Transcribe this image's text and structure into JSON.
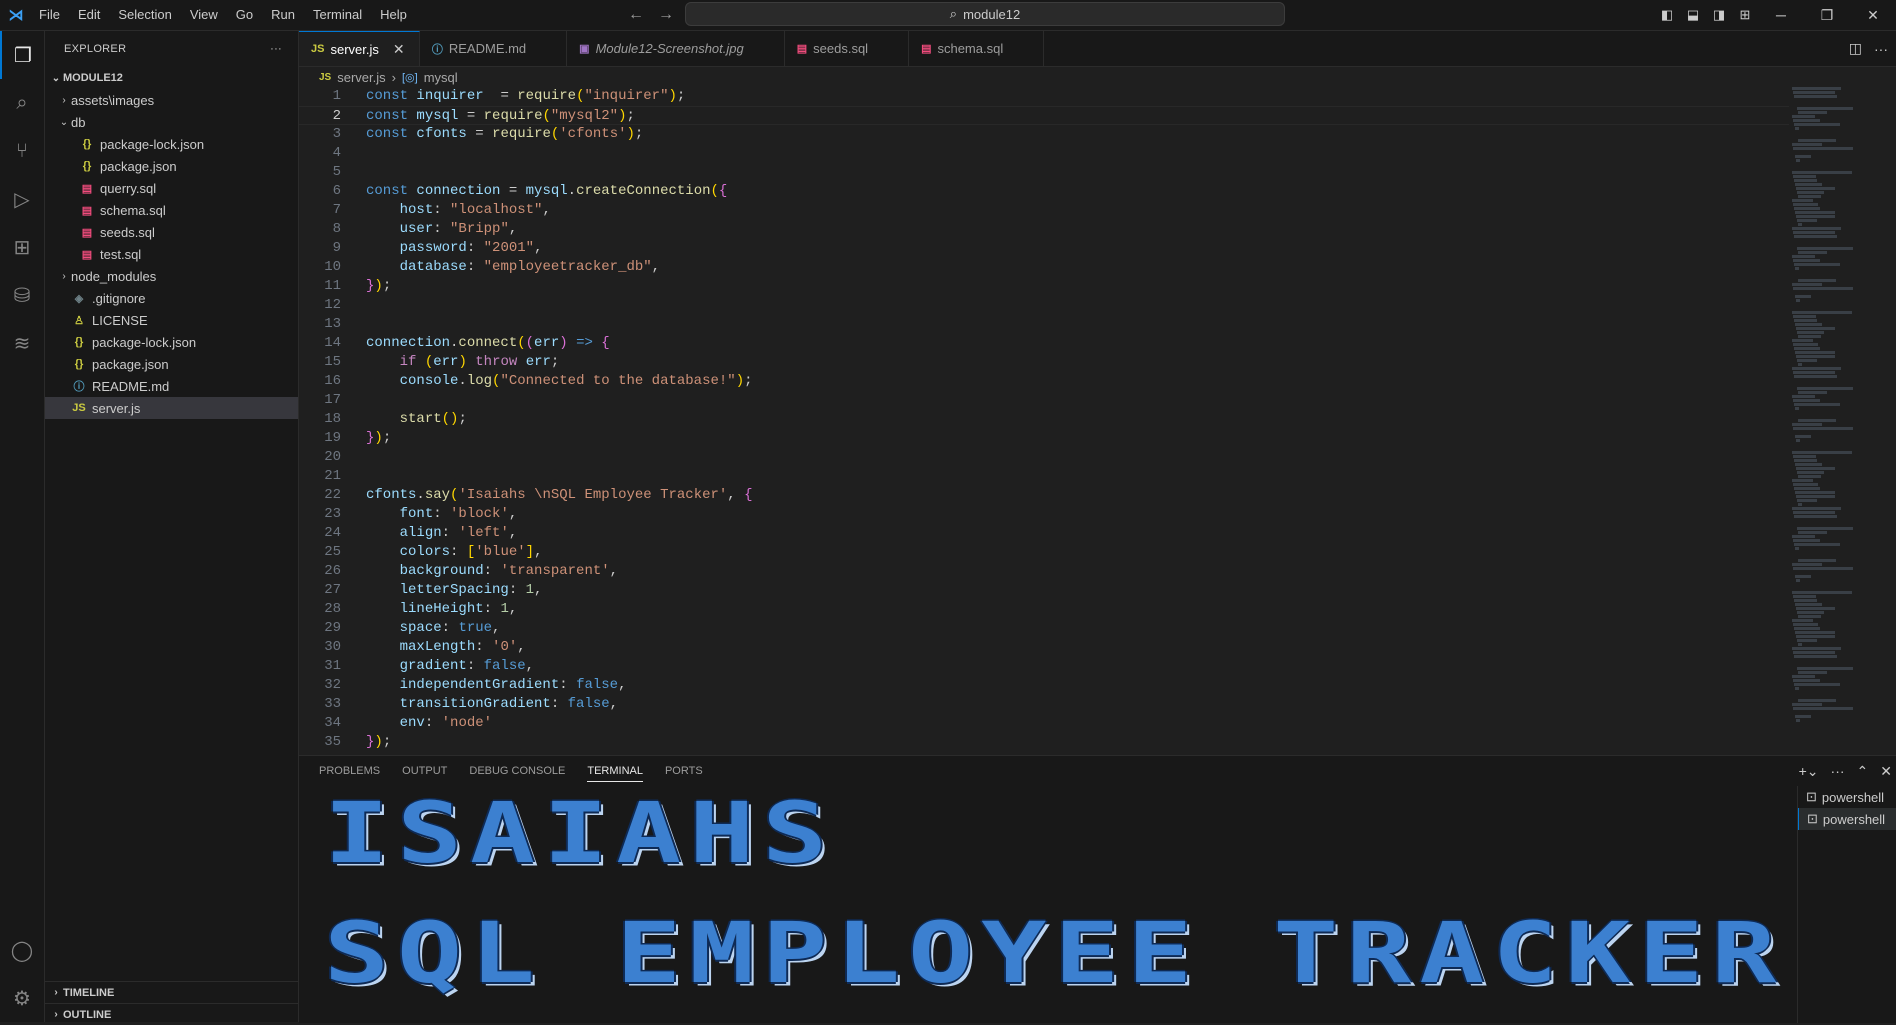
{
  "titlebar": {
    "menu": [
      "File",
      "Edit",
      "Selection",
      "View",
      "Go",
      "Run",
      "Terminal",
      "Help"
    ],
    "search_text": "module12"
  },
  "sidebar": {
    "title": "EXPLORER",
    "root": "MODULE12",
    "tree": [
      {
        "label": "assets\\images",
        "indent": 1,
        "twisty": "›",
        "icon": "",
        "icon_color": ""
      },
      {
        "label": "db",
        "indent": 1,
        "twisty": "⌄",
        "icon": "",
        "icon_color": ""
      },
      {
        "label": "package-lock.json",
        "indent": 2,
        "twisty": "",
        "icon": "{}",
        "icon_color": "#cbcb41"
      },
      {
        "label": "package.json",
        "indent": 2,
        "twisty": "",
        "icon": "{}",
        "icon_color": "#cbcb41"
      },
      {
        "label": "querry.sql",
        "indent": 2,
        "twisty": "",
        "icon": "▤",
        "icon_color": "#f14c7d"
      },
      {
        "label": "schema.sql",
        "indent": 2,
        "twisty": "",
        "icon": "▤",
        "icon_color": "#f14c7d"
      },
      {
        "label": "seeds.sql",
        "indent": 2,
        "twisty": "",
        "icon": "▤",
        "icon_color": "#f14c7d"
      },
      {
        "label": "test.sql",
        "indent": 2,
        "twisty": "",
        "icon": "▤",
        "icon_color": "#f14c7d"
      },
      {
        "label": "node_modules",
        "indent": 1,
        "twisty": "›",
        "icon": "",
        "icon_color": ""
      },
      {
        "label": ".gitignore",
        "indent": 1,
        "twisty": "",
        "icon": "◈",
        "icon_color": "#6d8086"
      },
      {
        "label": "LICENSE",
        "indent": 1,
        "twisty": "",
        "icon": "♙",
        "icon_color": "#cbcb41"
      },
      {
        "label": "package-lock.json",
        "indent": 1,
        "twisty": "",
        "icon": "{}",
        "icon_color": "#cbcb41"
      },
      {
        "label": "package.json",
        "indent": 1,
        "twisty": "",
        "icon": "{}",
        "icon_color": "#cbcb41"
      },
      {
        "label": "README.md",
        "indent": 1,
        "twisty": "",
        "icon": "ⓘ",
        "icon_color": "#519aba"
      },
      {
        "label": "server.js",
        "indent": 1,
        "twisty": "",
        "icon": "JS",
        "icon_color": "#cbcb41",
        "selected": true
      }
    ],
    "timeline": "TIMELINE",
    "outline": "OUTLINE"
  },
  "tabs": [
    {
      "label": "server.js",
      "icon": "JS",
      "icon_color": "#cbcb41",
      "active": true,
      "italic": false
    },
    {
      "label": "README.md",
      "icon": "ⓘ",
      "icon_color": "#519aba",
      "active": false,
      "italic": false
    },
    {
      "label": "Module12-Screenshot.jpg",
      "icon": "▣",
      "icon_color": "#a074c4",
      "active": false,
      "italic": true
    },
    {
      "label": "seeds.sql",
      "icon": "▤",
      "icon_color": "#f14c7d",
      "active": false,
      "italic": false
    },
    {
      "label": "schema.sql",
      "icon": "▤",
      "icon_color": "#f14c7d",
      "active": false,
      "italic": false
    }
  ],
  "breadcrumb": {
    "file": "server.js",
    "symbol": "mysql"
  },
  "editor": {
    "current_line": 2,
    "lines": [
      [
        [
          "kw",
          "const "
        ],
        [
          "var",
          "inquirer"
        ],
        [
          "",
          "  = "
        ],
        [
          "fn",
          "require"
        ],
        [
          "pun",
          "("
        ],
        [
          "str",
          "\"inquirer\""
        ],
        [
          "pun",
          ")"
        ],
        [
          "",
          ";"
        ]
      ],
      [
        [
          "kw",
          "const "
        ],
        [
          "var",
          "mysql"
        ],
        [
          "",
          " = "
        ],
        [
          "fn",
          "require"
        ],
        [
          "pun",
          "("
        ],
        [
          "str",
          "\"mysql2\""
        ],
        [
          "pun",
          ")"
        ],
        [
          "",
          ";"
        ]
      ],
      [
        [
          "kw",
          "const "
        ],
        [
          "var",
          "cfonts"
        ],
        [
          "",
          " = "
        ],
        [
          "fn",
          "require"
        ],
        [
          "pun",
          "("
        ],
        [
          "str",
          "'cfonts'"
        ],
        [
          "pun",
          ")"
        ],
        [
          "",
          ";"
        ]
      ],
      [],
      [],
      [
        [
          "kw",
          "const "
        ],
        [
          "var",
          "connection"
        ],
        [
          "",
          " = "
        ],
        [
          "var",
          "mysql"
        ],
        [
          "",
          "."
        ],
        [
          "fn",
          "createConnection"
        ],
        [
          "pun",
          "("
        ],
        [
          "pun2",
          "{"
        ]
      ],
      [
        [
          "",
          "    "
        ],
        [
          "var",
          "host"
        ],
        [
          "",
          ": "
        ],
        [
          "str",
          "\"localhost\""
        ],
        [
          "",
          ","
        ]
      ],
      [
        [
          "",
          "    "
        ],
        [
          "var",
          "user"
        ],
        [
          "",
          ": "
        ],
        [
          "str",
          "\"Bripp\""
        ],
        [
          "",
          ","
        ]
      ],
      [
        [
          "",
          "    "
        ],
        [
          "var",
          "password"
        ],
        [
          "",
          ": "
        ],
        [
          "str",
          "\"2001\""
        ],
        [
          "",
          ","
        ]
      ],
      [
        [
          "",
          "    "
        ],
        [
          "var",
          "database"
        ],
        [
          "",
          ": "
        ],
        [
          "str",
          "\"employeetracker_db\""
        ],
        [
          "",
          ","
        ]
      ],
      [
        [
          "pun2",
          "}"
        ],
        [
          "pun",
          ")"
        ],
        [
          "",
          ";"
        ]
      ],
      [],
      [],
      [
        [
          "var",
          "connection"
        ],
        [
          "",
          "."
        ],
        [
          "fn",
          "connect"
        ],
        [
          "pun",
          "("
        ],
        [
          "pun2",
          "("
        ],
        [
          "var",
          "err"
        ],
        [
          "pun2",
          ")"
        ],
        [
          "",
          " "
        ],
        [
          "kw",
          "=>"
        ],
        [
          "",
          " "
        ],
        [
          "pun2",
          "{"
        ]
      ],
      [
        [
          "",
          "    "
        ],
        [
          "kw2",
          "if"
        ],
        [
          "",
          " "
        ],
        [
          "pun",
          "("
        ],
        [
          "var",
          "err"
        ],
        [
          "pun",
          ")"
        ],
        [
          "",
          " "
        ],
        [
          "kw2",
          "throw"
        ],
        [
          "",
          " "
        ],
        [
          "var",
          "err"
        ],
        [
          "",
          ";"
        ]
      ],
      [
        [
          "",
          "    "
        ],
        [
          "var",
          "console"
        ],
        [
          "",
          "."
        ],
        [
          "fn",
          "log"
        ],
        [
          "pun",
          "("
        ],
        [
          "str",
          "\"Connected to the database!\""
        ],
        [
          "pun",
          ")"
        ],
        [
          "",
          ";"
        ]
      ],
      [],
      [
        [
          "",
          "    "
        ],
        [
          "fn",
          "start"
        ],
        [
          "pun",
          "()"
        ],
        [
          "",
          ";"
        ]
      ],
      [
        [
          "pun2",
          "}"
        ],
        [
          "pun",
          ")"
        ],
        [
          "",
          ";"
        ]
      ],
      [],
      [],
      [
        [
          "var",
          "cfonts"
        ],
        [
          "",
          "."
        ],
        [
          "fn",
          "say"
        ],
        [
          "pun",
          "("
        ],
        [
          "str",
          "'Isaiahs \\nSQL Employee Tracker'"
        ],
        [
          "",
          ", "
        ],
        [
          "pun2",
          "{"
        ]
      ],
      [
        [
          "",
          "    "
        ],
        [
          "var",
          "font"
        ],
        [
          "",
          ": "
        ],
        [
          "str",
          "'block'"
        ],
        [
          "",
          ","
        ]
      ],
      [
        [
          "",
          "    "
        ],
        [
          "var",
          "align"
        ],
        [
          "",
          ": "
        ],
        [
          "str",
          "'left'"
        ],
        [
          "",
          ","
        ]
      ],
      [
        [
          "",
          "    "
        ],
        [
          "var",
          "colors"
        ],
        [
          "",
          ": "
        ],
        [
          "pun",
          "["
        ],
        [
          "str",
          "'blue'"
        ],
        [
          "pun",
          "]"
        ],
        [
          "",
          ","
        ]
      ],
      [
        [
          "",
          "    "
        ],
        [
          "var",
          "background"
        ],
        [
          "",
          ": "
        ],
        [
          "str",
          "'transparent'"
        ],
        [
          "",
          ","
        ]
      ],
      [
        [
          "",
          "    "
        ],
        [
          "var",
          "letterSpacing"
        ],
        [
          "",
          ": "
        ],
        [
          "num",
          "1"
        ],
        [
          "",
          ","
        ]
      ],
      [
        [
          "",
          "    "
        ],
        [
          "var",
          "lineHeight"
        ],
        [
          "",
          ": "
        ],
        [
          "num",
          "1"
        ],
        [
          "",
          ","
        ]
      ],
      [
        [
          "",
          "    "
        ],
        [
          "var",
          "space"
        ],
        [
          "",
          ": "
        ],
        [
          "bool",
          "true"
        ],
        [
          "",
          ","
        ]
      ],
      [
        [
          "",
          "    "
        ],
        [
          "var",
          "maxLength"
        ],
        [
          "",
          ": "
        ],
        [
          "str",
          "'0'"
        ],
        [
          "",
          ","
        ]
      ],
      [
        [
          "",
          "    "
        ],
        [
          "var",
          "gradient"
        ],
        [
          "",
          ": "
        ],
        [
          "bool",
          "false"
        ],
        [
          "",
          ","
        ]
      ],
      [
        [
          "",
          "    "
        ],
        [
          "var",
          "independentGradient"
        ],
        [
          "",
          ": "
        ],
        [
          "bool",
          "false"
        ],
        [
          "",
          ","
        ]
      ],
      [
        [
          "",
          "    "
        ],
        [
          "var",
          "transitionGradient"
        ],
        [
          "",
          ": "
        ],
        [
          "bool",
          "false"
        ],
        [
          "",
          ","
        ]
      ],
      [
        [
          "",
          "    "
        ],
        [
          "var",
          "env"
        ],
        [
          "",
          ": "
        ],
        [
          "str",
          "'node'"
        ]
      ],
      [
        [
          "pun2",
          "}"
        ],
        [
          "pun",
          ")"
        ],
        [
          "",
          ";"
        ]
      ]
    ]
  },
  "panel": {
    "tabs": [
      "PROBLEMS",
      "OUTPUT",
      "DEBUG CONSOLE",
      "TERMINAL",
      "PORTS"
    ],
    "active_tab": "TERMINAL",
    "terminals": [
      "powershell",
      "powershell"
    ],
    "banner_lines": [
      "ISAIAHS",
      "SQL EMPLOYEE TRACKER"
    ]
  },
  "colors": {
    "accent": "#0078d4",
    "banner": "#3c80d0"
  }
}
